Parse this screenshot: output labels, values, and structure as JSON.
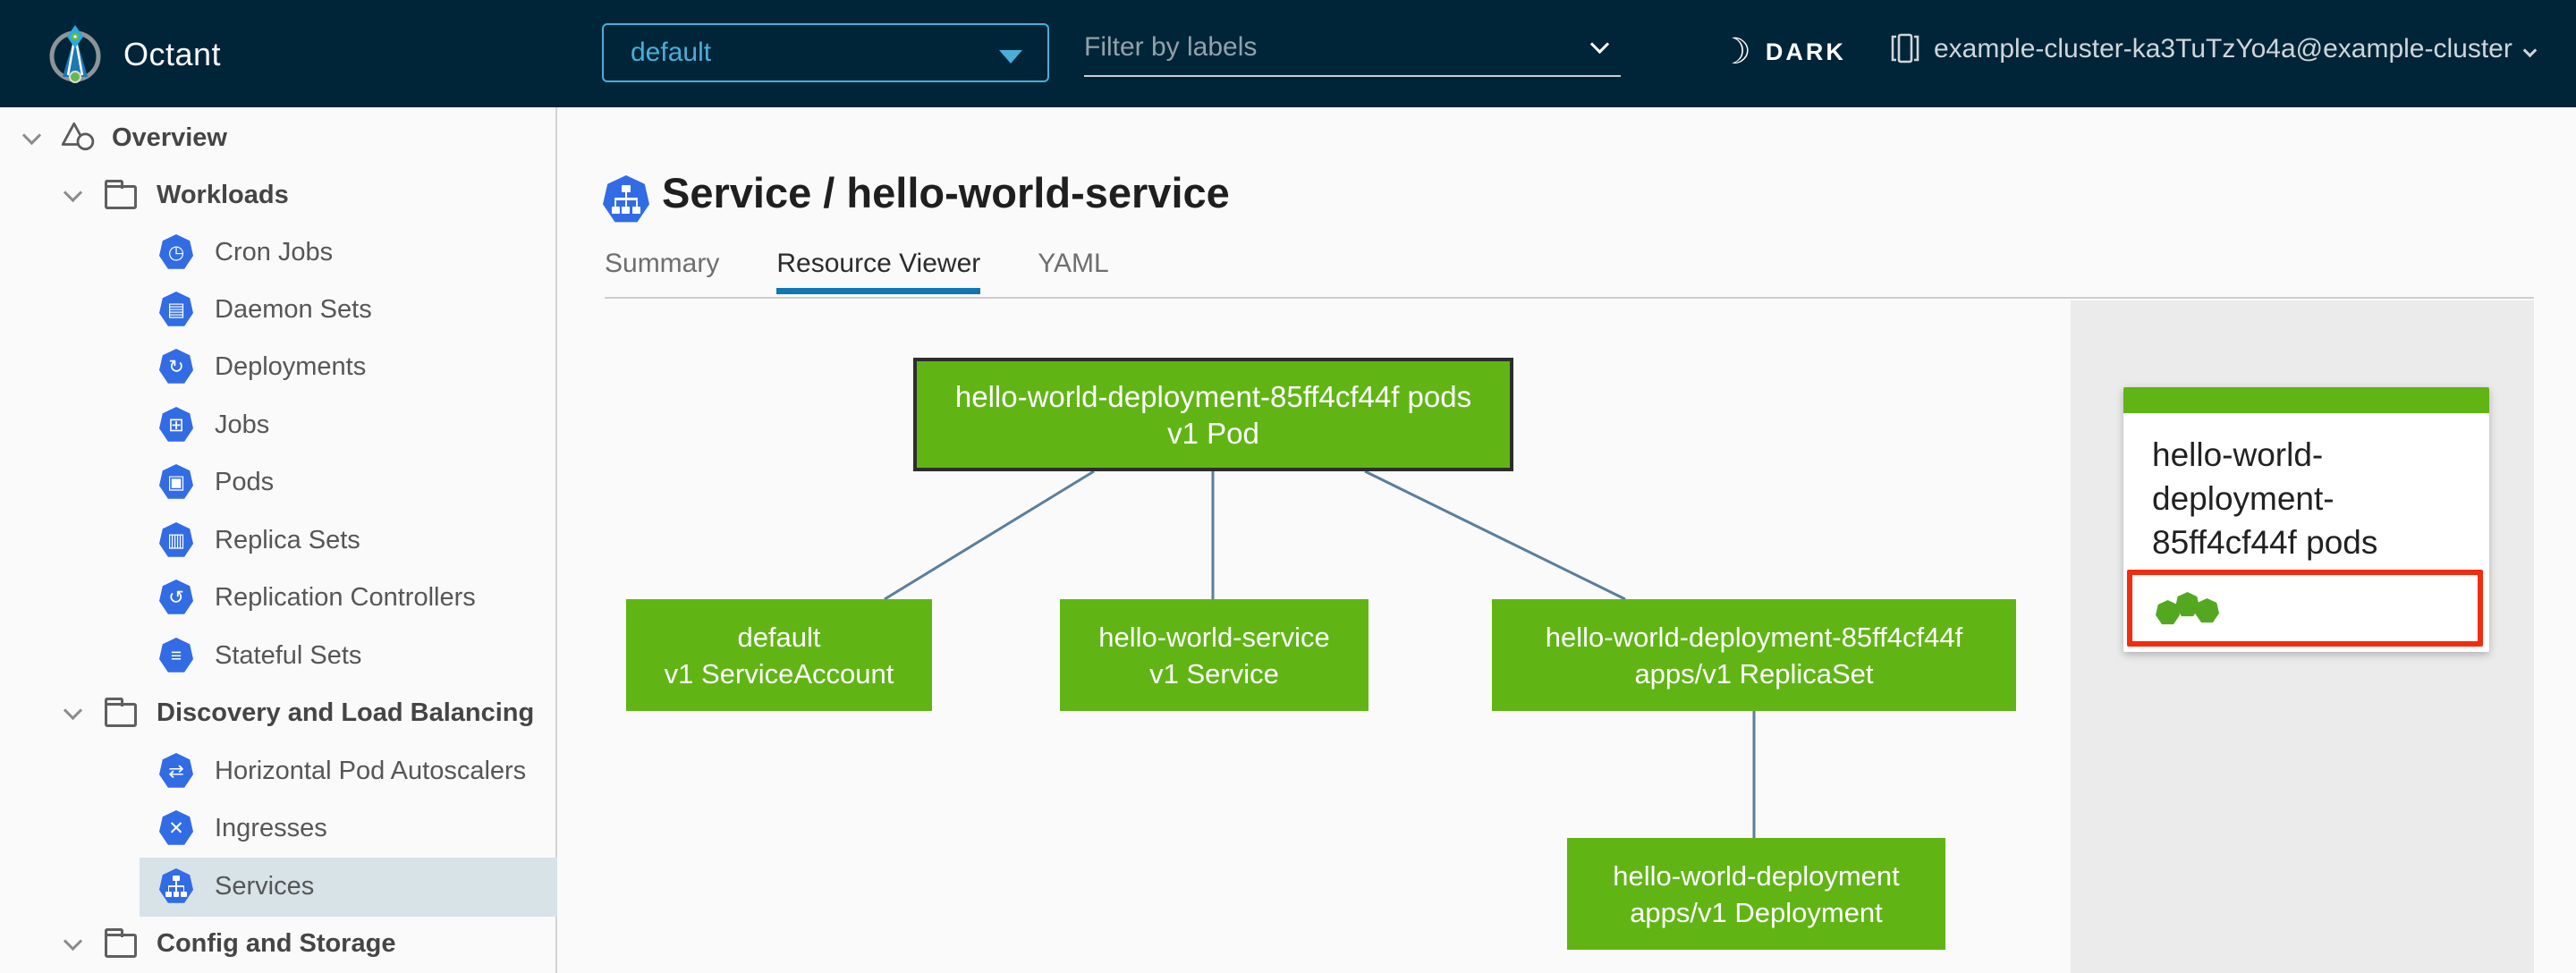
{
  "colors": {
    "header_bg": "#002538",
    "accent_blue": "#49afd9",
    "node_green": "#60b515",
    "selected_node_border": "#2d2d2d",
    "edge_blue": "#5b7e9c",
    "highlight_red": "#f22c0e",
    "k8s_icon_blue": "#326ce5",
    "selected_nav_bg": "#d8e3e8",
    "tab_active_underline": "#0d77b8",
    "panel_bg": "#ebebeb",
    "status_dot_green": "#54a81f"
  },
  "header": {
    "app_name": "Octant",
    "logo_icon": "octant-compass-logo",
    "namespace_dropdown": {
      "value": "default",
      "caret_icon": "caret-down-icon"
    },
    "filter_input": {
      "placeholder": "Filter by labels",
      "chevron_icon": "chevron-down-icon"
    },
    "theme_toggle": {
      "label": "DARK",
      "icon": "moon-icon"
    },
    "cluster_selector": {
      "value": "example-cluster-ka3TuTzYo4a@example-cluster",
      "icon": "cluster-icon",
      "chevron_icon": "chevron-down-icon"
    }
  },
  "sidebar": {
    "items": [
      {
        "label": "Overview",
        "level": "root",
        "expanded": true,
        "icon": "objects-icon"
      },
      {
        "label": "Workloads",
        "level": "group",
        "expanded": true,
        "icon": "folder-icon"
      },
      {
        "label": "Cron Jobs",
        "level": "leaf",
        "icon": "cronjob-icon",
        "glyph": "◷"
      },
      {
        "label": "Daemon Sets",
        "level": "leaf",
        "icon": "daemonset-icon",
        "glyph": "▤"
      },
      {
        "label": "Deployments",
        "level": "leaf",
        "icon": "deployment-icon",
        "glyph": "↻"
      },
      {
        "label": "Jobs",
        "level": "leaf",
        "icon": "job-icon",
        "glyph": "⊞"
      },
      {
        "label": "Pods",
        "level": "leaf",
        "icon": "pod-icon",
        "glyph": "▣"
      },
      {
        "label": "Replica Sets",
        "level": "leaf",
        "icon": "replicaset-icon",
        "glyph": "▥"
      },
      {
        "label": "Replication Controllers",
        "level": "leaf",
        "icon": "replicationcontroller-icon",
        "glyph": "↺"
      },
      {
        "label": "Stateful Sets",
        "level": "leaf",
        "icon": "statefulset-icon",
        "glyph": "≡"
      },
      {
        "label": "Discovery and Load Balancing",
        "level": "group",
        "expanded": true,
        "icon": "folder-icon"
      },
      {
        "label": "Horizontal Pod Autoscalers",
        "level": "leaf",
        "icon": "hpa-icon",
        "glyph": "⇄"
      },
      {
        "label": "Ingresses",
        "level": "leaf",
        "icon": "ingress-icon",
        "glyph": "✕"
      },
      {
        "label": "Services",
        "level": "leaf",
        "icon": "service-icon",
        "glyph": "network-tree",
        "selected": true
      },
      {
        "label": "Config and Storage",
        "level": "group",
        "expanded": true,
        "icon": "folder-icon"
      }
    ]
  },
  "main": {
    "title": "Service / hello-world-service",
    "title_icon": "service-icon",
    "tabs": [
      {
        "label": "Summary",
        "active": false
      },
      {
        "label": "Resource Viewer",
        "active": true
      },
      {
        "label": "YAML",
        "active": false
      }
    ],
    "graph": {
      "nodes": [
        {
          "id": "pod",
          "line1": "hello-world-deployment-85ff4cf44f pods",
          "line2": "v1 Pod",
          "selected": true
        },
        {
          "id": "serviceaccount",
          "line1": "default",
          "line2": "v1 ServiceAccount",
          "selected": false
        },
        {
          "id": "service",
          "line1": "hello-world-service",
          "line2": "v1 Service",
          "selected": false
        },
        {
          "id": "replicaset",
          "line1": "hello-world-deployment-85ff4cf44f",
          "line2": "apps/v1 ReplicaSet",
          "selected": false
        },
        {
          "id": "deployment",
          "line1": "hello-world-deployment",
          "line2": "apps/v1 Deployment",
          "selected": false
        }
      ],
      "edges": [
        {
          "from": "pod",
          "to": "serviceaccount"
        },
        {
          "from": "pod",
          "to": "service"
        },
        {
          "from": "pod",
          "to": "replicaset"
        },
        {
          "from": "replicaset",
          "to": "deployment"
        }
      ]
    },
    "detail_panel": {
      "card": {
        "title": "hello-world-deployment-85ff4cf44f pods",
        "pod_status_dots": 3,
        "highlighted": true
      }
    }
  }
}
